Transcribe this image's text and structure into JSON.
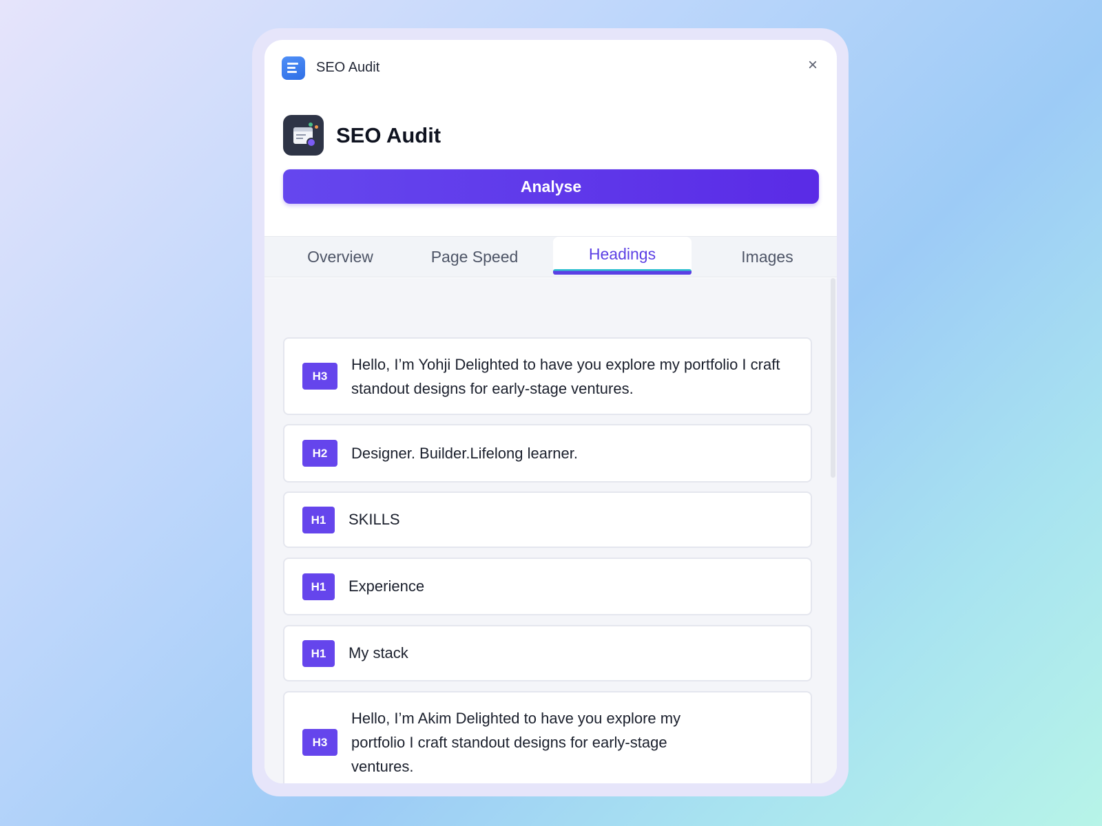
{
  "window": {
    "title": "SEO Audit",
    "close_symbol": "×"
  },
  "app": {
    "name": "SEO Audit",
    "analyse_label": "Analyse"
  },
  "tabs": [
    {
      "label": "Overview",
      "active": false
    },
    {
      "label": "Page Speed",
      "active": false
    },
    {
      "label": "Headings",
      "active": true
    },
    {
      "label": "Images",
      "active": false
    }
  ],
  "headings": [
    {
      "level": "H3",
      "text": "Hello, I’m Yohji Delighted to have you explore my portfolio I craft standout designs for early-stage ventures."
    },
    {
      "level": "H2",
      "text": "Designer. Builder.Lifelong learner."
    },
    {
      "level": "H1",
      "text": "SKILLS"
    },
    {
      "level": "H1",
      "text": "Experience"
    },
    {
      "level": "H1",
      "text": "My stack"
    },
    {
      "level": "H3",
      "text": "Hello, I’m Akim Delighted to have you explore my portfolio I craft standout designs for early-stage ventures."
    }
  ],
  "colors": {
    "accent": "#5b3fe4",
    "badge": "#6545ec",
    "tab_underline_secondary": "#2fc0d0"
  }
}
